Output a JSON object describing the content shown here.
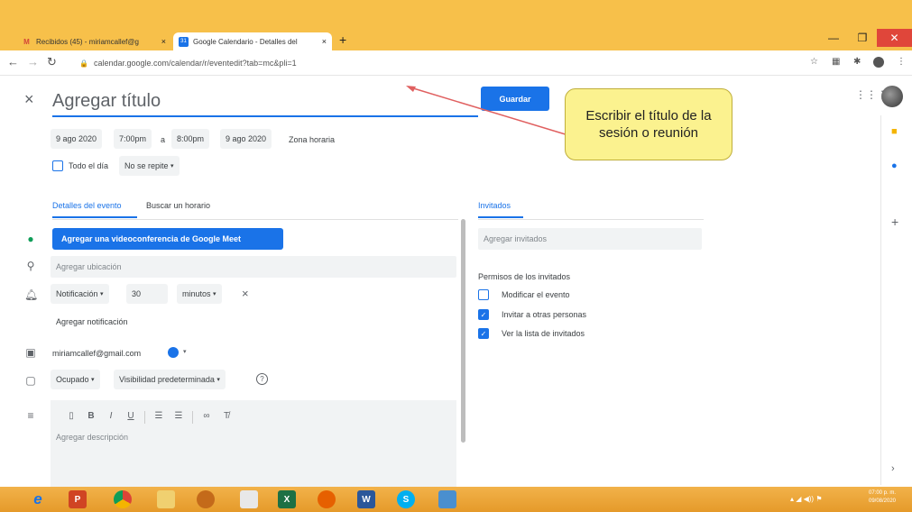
{
  "browser": {
    "tabs": [
      {
        "label": "Recibidos (45) - miriamcallef@g",
        "close": "×"
      },
      {
        "label": "Google Calendario - Detalles del",
        "close": "×"
      }
    ],
    "new_tab": "+",
    "url": "calendar.google.com/calendar/r/eventedit?tab=mc&pli=1",
    "window_controls": {
      "minimize": "—",
      "maximize": "❐",
      "close": "✕"
    }
  },
  "editor": {
    "close_label": "×",
    "title_placeholder": "Agregar título",
    "save_label": "Guardar",
    "start_date": "9 ago 2020",
    "start_time": "7:00pm",
    "to_label": "a",
    "end_time": "8:00pm",
    "end_date": "9 ago 2020",
    "timezone": "Zona horaria",
    "all_day": "Todo el día",
    "repeat": "No se repite",
    "tabs": {
      "details": "Detalles del evento",
      "schedule": "Buscar un horario"
    },
    "meet_button": "Agregar una videoconferencia de Google Meet",
    "location_placeholder": "Agregar ubicación",
    "notification": {
      "type": "Notificación",
      "value": "30",
      "unit": "minutos",
      "remove": "×"
    },
    "add_notification": "Agregar notificación",
    "calendar_owner": "miriamcallef@gmail.com",
    "busy": "Ocupado",
    "visibility": "Visibilidad predeterminada",
    "help": "?",
    "description_placeholder": "Agregar descripción"
  },
  "guests": {
    "tab": "Invitados",
    "input_placeholder": "Agregar invitados",
    "permissions_title": "Permisos de los invitados",
    "permissions": [
      {
        "label": "Modificar el evento",
        "checked": false
      },
      {
        "label": "Invitar a otras personas",
        "checked": true
      },
      {
        "label": "Ver la lista de invitados",
        "checked": true
      }
    ]
  },
  "callout": {
    "text": "Escribir el título de la sesión o reunión"
  },
  "taskbar": {
    "clock_time": "07:00 p. m.",
    "clock_date": "09/08/2020"
  },
  "colors": {
    "accent": "#1a73e8",
    "callout": "#fbf28f",
    "taskbar": "#f2b24a"
  }
}
